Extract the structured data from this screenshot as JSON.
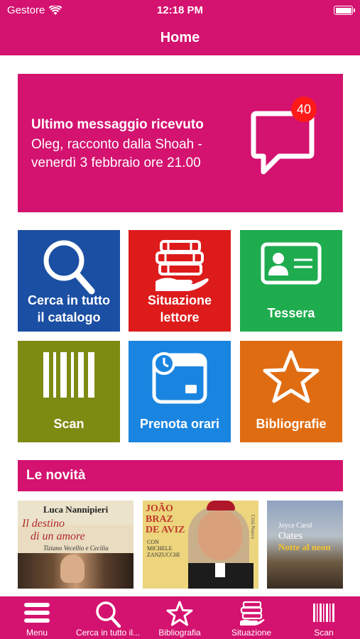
{
  "status_bar": {
    "carrier": "Gestore",
    "time": "12:18 PM"
  },
  "nav": {
    "title": "Home"
  },
  "message": {
    "title": "Ultimo messaggio ricevuto",
    "line1": "Oleg, racconto dalla Shoah -",
    "line2": "venerdì 3 febbraio ore 21.00",
    "badge": "40",
    "icon": "chat-bubble-icon"
  },
  "tiles": [
    {
      "line1": "Cerca in tutto",
      "line2": "il catalogo",
      "icon": "search-icon",
      "color": "#1a4fa3"
    },
    {
      "line1": "Situazione",
      "line2": "lettore",
      "icon": "books-hand-icon",
      "color": "#dd1b1b"
    },
    {
      "line1": "Tessera",
      "icon": "id-card-icon",
      "color": "#1fac4f"
    },
    {
      "line1": "Scan",
      "icon": "barcode-icon",
      "color": "#7e8b12"
    },
    {
      "line1": "Prenota orari",
      "icon": "calendar-clock-icon",
      "color": "#1a85e0"
    },
    {
      "line1": "Bibliografie",
      "icon": "star-icon",
      "color": "#e06c12"
    }
  ],
  "section": {
    "title": "Le novità"
  },
  "books": [
    {
      "author": "Luca Nannipieri",
      "title1": "Il destino",
      "title2": "di un amore",
      "subtitle": "Tiziano Vecellio e Cecilia"
    },
    {
      "title1": "JOÃO",
      "title2": "BRAZ",
      "title3": "DE AVIZ",
      "con": "CON",
      "coauthor1": "MICHELE",
      "coauthor2": "ZANZUCCHI",
      "publisher": "Città Nuova"
    },
    {
      "author1": "Joyce Carol",
      "author2": "Oates",
      "title": "Notte al neon"
    }
  ],
  "tab_bar": [
    {
      "label": "Menu",
      "icon": "menu-icon"
    },
    {
      "label": "Cerca in tutto il...",
      "icon": "search-icon"
    },
    {
      "label": "Bibliografia",
      "icon": "star-icon"
    },
    {
      "label": "Situazione",
      "icon": "books-hand-icon"
    },
    {
      "label": "Scan",
      "icon": "barcode-icon"
    }
  ],
  "colors": {
    "brand": "#d4126f",
    "badge": "#ff1a1a"
  }
}
